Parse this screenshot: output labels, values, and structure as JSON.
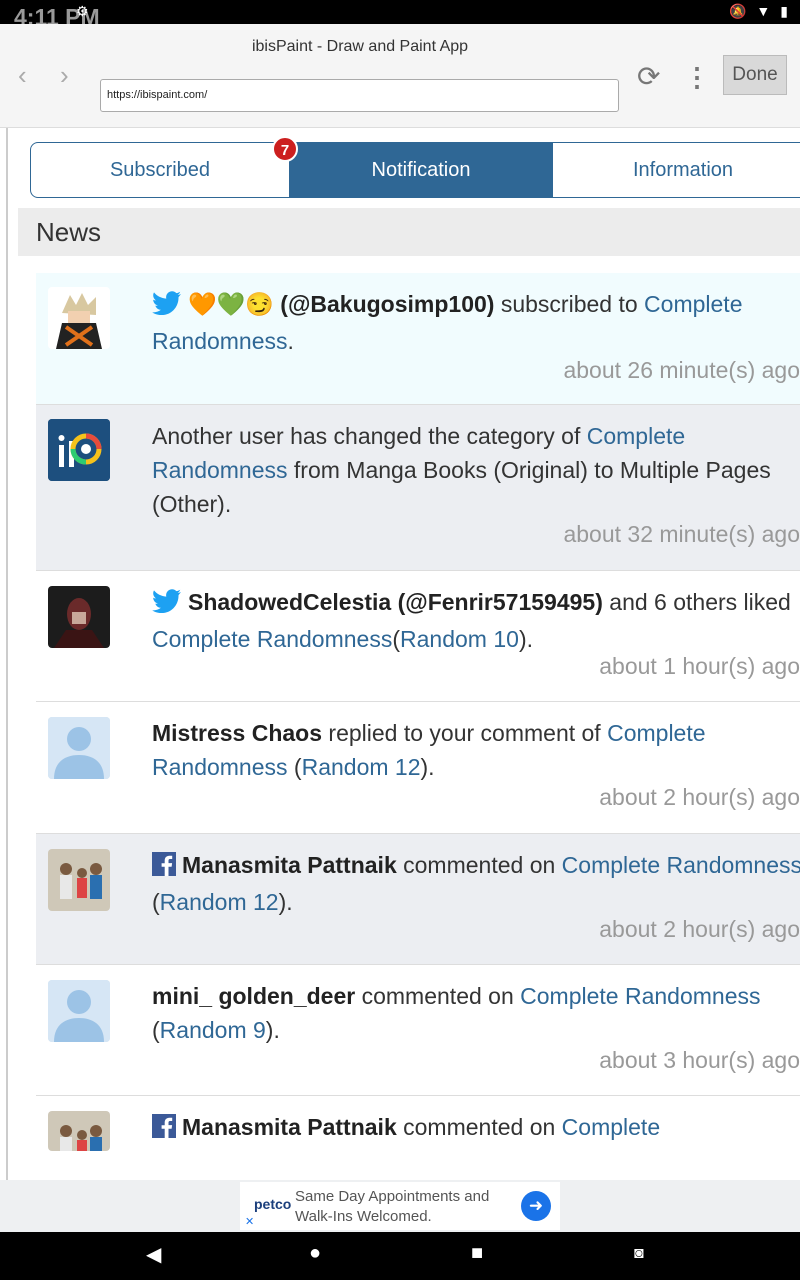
{
  "status_bar": {
    "time": "4:11 PM"
  },
  "browser": {
    "title": "ibisPaint - Draw and Paint App",
    "url": "https://ibispaint.com/",
    "done_label": "Done"
  },
  "tabs": [
    {
      "label": "Subscribed",
      "active": false
    },
    {
      "label": "Notification",
      "active": true
    },
    {
      "label": "Information",
      "active": false
    }
  ],
  "badge_count": "7",
  "news_header": "News",
  "feed": [
    {
      "source_icon": "twitter-icon",
      "avatar": "anime-avatar-bakugo",
      "user": "🧡💚😏 (@Bakugosimp100)",
      "action": " subscribed to ",
      "link1": "Complete Randomness",
      "mid": "",
      "link2": "",
      "tail": ".",
      "time": "about 26 minute(s) ago"
    },
    {
      "source_icon": "",
      "avatar": "ibispaint-logo-avatar",
      "user": "",
      "action": "Another user has changed the category of ",
      "link1": "Complete Randomness",
      "mid": " from Manga Books (Original) to Multiple Pages (Other).",
      "link2": "",
      "tail": "",
      "time": "about 32 minute(s) ago"
    },
    {
      "source_icon": "twitter-icon",
      "avatar": "dark-figure-avatar",
      "user": "ShadowedCelestia (@Fenrir57159495)",
      "action": " and 6 others liked ",
      "link1": "Complete Randomness",
      "mid": "(",
      "link2": "Random 10",
      "tail": ").",
      "time": "about 1 hour(s) ago"
    },
    {
      "source_icon": "",
      "avatar": "default-user-avatar",
      "user": "Mistress Chaos",
      "action": " replied to your comment of ",
      "link1": "Complete Randomness",
      "mid": " (",
      "link2": "Random 12",
      "tail": ").",
      "time": "about 2 hour(s) ago"
    },
    {
      "source_icon": "facebook-icon",
      "avatar": "photo-avatar-family",
      "user": "Manasmita Pattnaik",
      "action": " commented on ",
      "link1": "Complete Randomness",
      "mid": " (",
      "link2": "Random 12",
      "tail": ").",
      "time": "about 2 hour(s) ago"
    },
    {
      "source_icon": "",
      "avatar": "default-user-avatar",
      "user": "mini_ golden_deer",
      "action": " commented on ",
      "link1": "Complete Randomness",
      "mid": " (",
      "link2": "Random 9",
      "tail": ").",
      "time": "about 3 hour(s) ago"
    },
    {
      "source_icon": "facebook-icon",
      "avatar": "photo-avatar-family",
      "user": "Manasmita Pattnaik",
      "action": " commented on ",
      "link1": "Complete",
      "mid": "",
      "link2": "",
      "tail": "",
      "time": ""
    }
  ],
  "ad": {
    "brand": "petco",
    "line1": "Same Day Appointments and",
    "line2": "Walk-Ins Welcomed."
  },
  "colors": {
    "accent": "#2f6795",
    "badge": "#cc1f1f",
    "twitter": "#1da1f2",
    "facebook": "#3b5998"
  }
}
